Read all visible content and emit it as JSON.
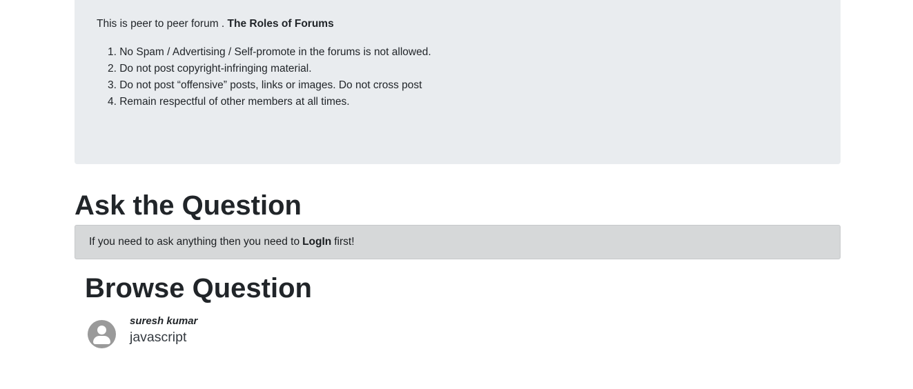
{
  "jumbotron": {
    "intro_text": "This is peer to peer forum .",
    "intro_bold": "The Roles of Forums",
    "rules": [
      "1. No Spam / Advertising / Self-promote in the forums is not allowed.",
      "2. Do not post copyright-infringing material.",
      "3. Do not post “offensive” posts, links or images. Do not cross post",
      "4. Remain respectful of other members at all times."
    ]
  },
  "ask_section": {
    "title": "Ask the Question",
    "alert_before": "If you need to ask anything then you need to",
    "alert_link": "LogIn",
    "alert_after": "first!"
  },
  "browse_section": {
    "title": "Browse Question",
    "questions": [
      {
        "author": "suresh kumar",
        "title": "javascript",
        "avatar_icon": "user-avatar-icon"
      }
    ]
  },
  "colors": {
    "jumbotron_bg": "#e9ecef",
    "alert_bg": "#d6d8d9",
    "avatar_bg": "#9a9a9a",
    "text": "#212529"
  }
}
